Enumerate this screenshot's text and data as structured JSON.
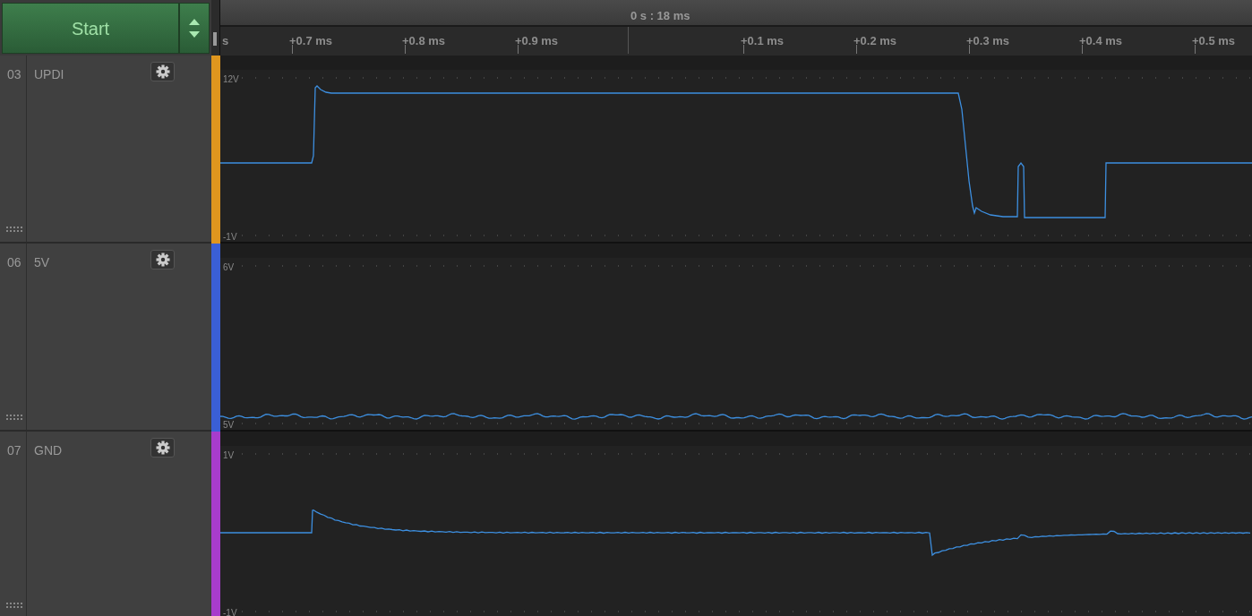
{
  "start_button": {
    "label": "Start"
  },
  "timeline": {
    "title": "0 s : 18 ms",
    "ticks": [
      "s",
      "+0.7 ms",
      "+0.8 ms",
      "+0.9 ms",
      "+0.1 ms",
      "+0.2 ms",
      "+0.3 ms",
      "+0.4 ms",
      "+0.5 ms"
    ]
  },
  "channels": [
    {
      "number": "03",
      "name": "UPDI",
      "color": "#e0961e",
      "y_top": "12V",
      "y_bottom": "-1V",
      "kind": "pulse"
    },
    {
      "number": "06",
      "name": "5V",
      "color": "#3a5fd6",
      "y_top": "6V",
      "y_bottom": "5V",
      "kind": "noise"
    },
    {
      "number": "07",
      "name": "GND",
      "color": "#a83ccc",
      "y_top": "1V",
      "y_bottom": "-1V",
      "kind": "ripple"
    }
  ]
}
